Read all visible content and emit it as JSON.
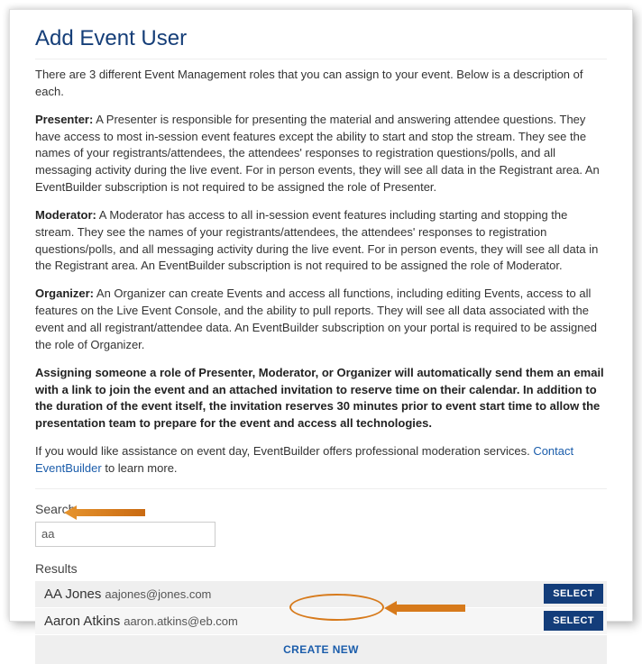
{
  "title": "Add Event User",
  "intro": "There are 3 different Event Management roles that you can assign to your event. Below is a description of each.",
  "roles": {
    "presenter_label": "Presenter:",
    "presenter_text": " A Presenter is responsible for presenting the material and answering attendee questions. They have access to most in-session event features except the ability to start and stop the stream. They see the names of your registrants/attendees, the attendees' responses to registration questions/polls, and all messaging activity during the live event. For in person events, they will see all data in the Registrant area. An EventBuilder subscription is not required to be assigned the role of Presenter.",
    "moderator_label": "Moderator:",
    "moderator_text": " A Moderator has access to all in-session event features including starting and stopping the stream. They see the names of your registrants/attendees, the attendees' responses to registration questions/polls, and all messaging activity during the live event. For in person events, they will see all data in the Registrant area. An EventBuilder subscription is not required to be assigned the role of Moderator.",
    "organizer_label": "Organizer:",
    "organizer_text": " An Organizer can create Events and access all functions, including editing Events, access to all features on the Live Event Console, and the ability to pull reports. They will see all data associated with the event and all registrant/attendee data. An EventBuilder subscription on your portal is required to be assigned the role of Organizer."
  },
  "assign_note": "Assigning someone a role of Presenter, Moderator, or Organizer will automatically send them an email with a link to join the event and an attached invitation to reserve time on their calendar. In addition to the duration of the event itself, the invitation reserves 30 minutes prior to event start time to allow the presentation team to prepare for the event and access all technologies.",
  "assist_pre": "If you would like assistance on event day, EventBuilder offers professional moderation services. ",
  "assist_link": "Contact EventBuilder",
  "assist_post": " to learn more.",
  "search": {
    "label": "Search",
    "value": "aa",
    "results_label": "Results",
    "select_label": "SELECT",
    "create_label": "CREATE NEW",
    "results": [
      {
        "name": "AA Jones",
        "email": "aajones@jones.com"
      },
      {
        "name": "Aaron Atkins",
        "email": "aaron.atkins@eb.com"
      }
    ]
  }
}
